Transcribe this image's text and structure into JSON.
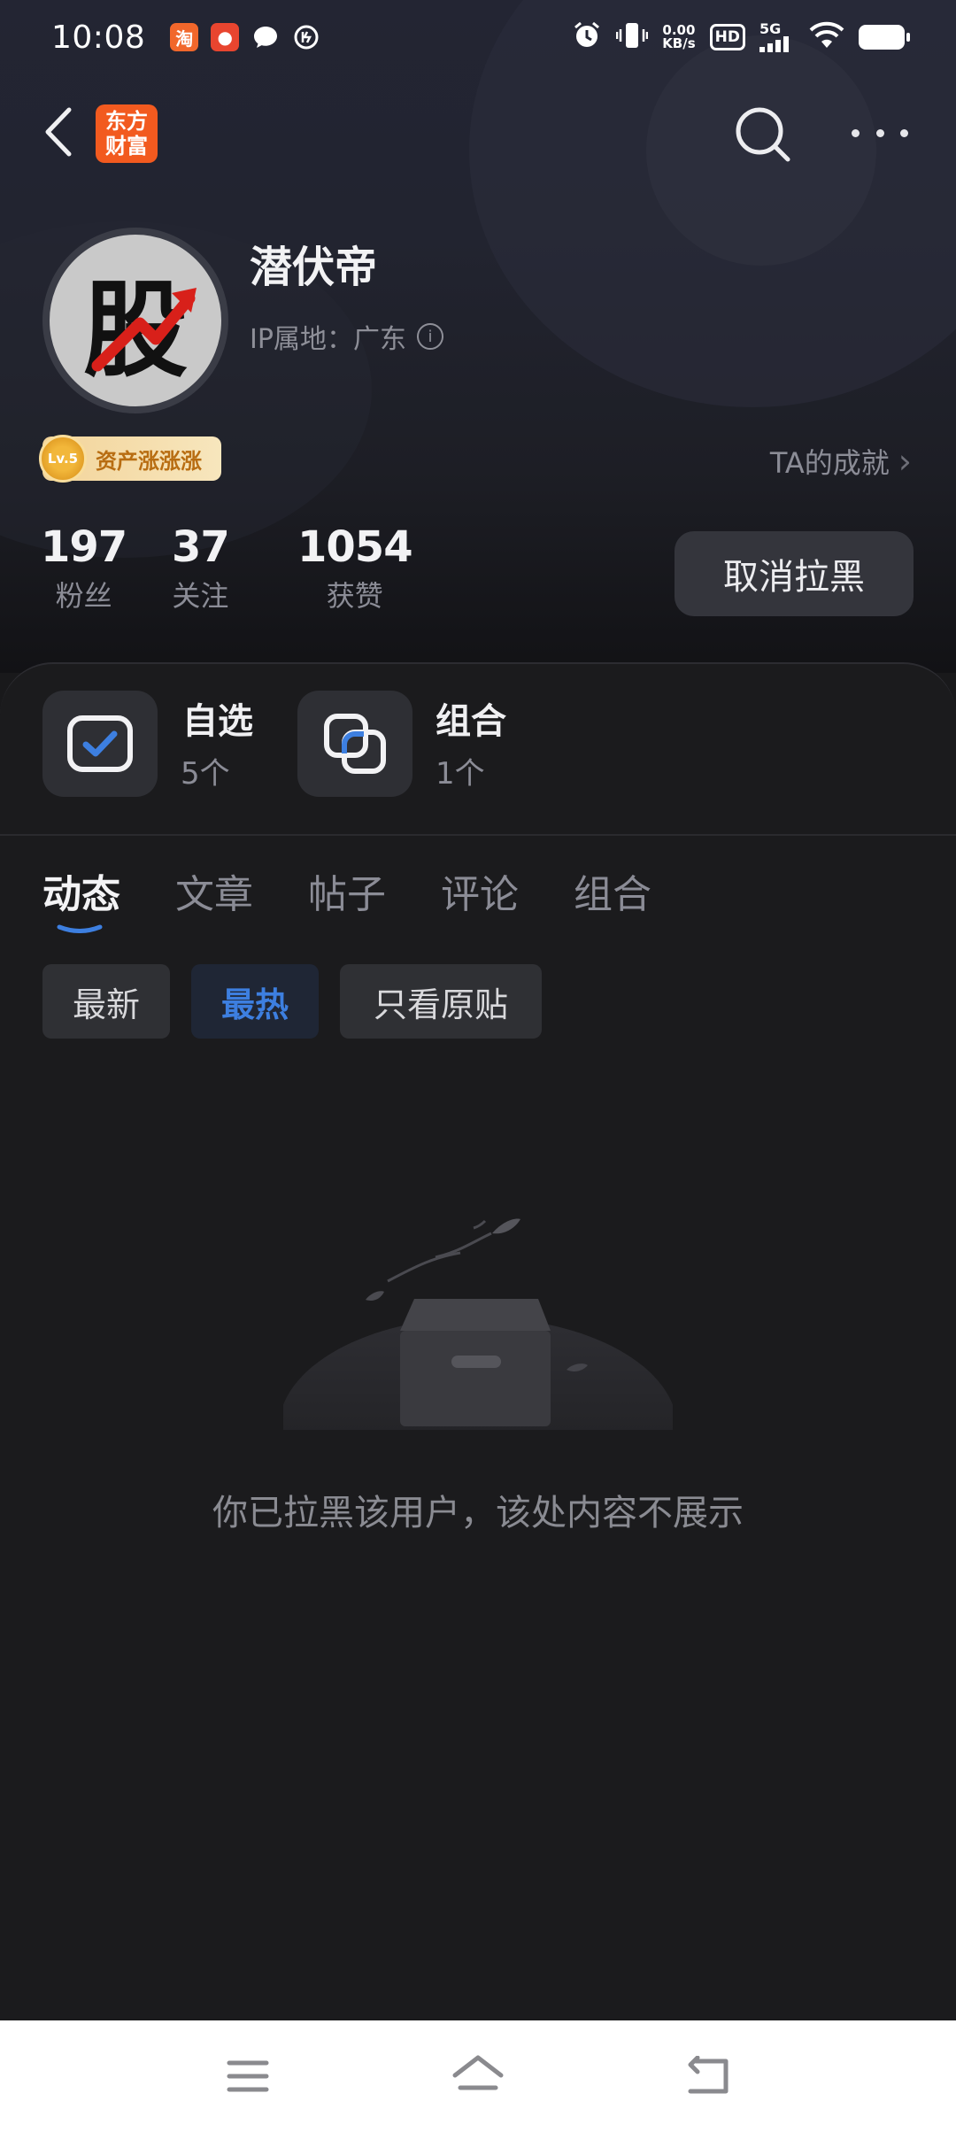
{
  "status_bar": {
    "time": "10:08",
    "network_speed_value": "0.00",
    "network_speed_unit": "KB/s",
    "hd_label": "HD",
    "signal_label": "5G",
    "app_icons": [
      "taobao-icon",
      "game-icon",
      "message-icon",
      "sync-icon"
    ],
    "system_icons": [
      "alarm-icon",
      "vibrate-icon",
      "wifi-icon",
      "battery-icon"
    ]
  },
  "nav": {
    "back_icon": "chevron-left-icon",
    "logo_line1": "东方",
    "logo_line2": "财富",
    "search_icon": "search-icon",
    "more_icon": "more-dots-icon"
  },
  "profile": {
    "avatar_char": "股",
    "username": "潜伏帝",
    "ip_location": "IP属地：广东",
    "level": "Lv.5",
    "badge_label": "资产涨涨涨",
    "achievement_label": "TA的成就",
    "achievement_arrow": "›",
    "stats": [
      {
        "value": "197",
        "label": "粉丝"
      },
      {
        "value": "37",
        "label": "关注"
      },
      {
        "value": "1054",
        "label": "获赞"
      }
    ],
    "unblock_label": "取消拉黑"
  },
  "shortcuts": [
    {
      "title": "自选",
      "count": "5个",
      "icon": "watchlist-check-icon"
    },
    {
      "title": "组合",
      "count": "1个",
      "icon": "portfolio-icon"
    }
  ],
  "tabs": [
    "动态",
    "文章",
    "帖子",
    "评论",
    "组合"
  ],
  "active_tab": "动态",
  "filters": [
    "最新",
    "最热",
    "只看原贴"
  ],
  "active_filter": "最热",
  "empty_state": {
    "icon": "empty-box-icon",
    "message": "你已拉黑该用户，该处内容不展示"
  },
  "system_nav": [
    "menu-icon",
    "home-icon",
    "back-icon"
  ],
  "colors": {
    "accent": "#3d7fe0",
    "logo": "#f25a1f",
    "badge_gold": "#f3d49a",
    "background": "#19191b"
  }
}
